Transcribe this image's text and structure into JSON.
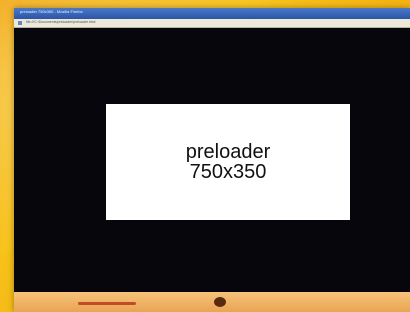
{
  "window": {
    "title": "preloader 750x350 - Mozilla Firefox",
    "url": "file:///C:/Documents/preloader/preloader.html"
  },
  "content": {
    "preloader_line1": "preloader",
    "preloader_line2": "750x350"
  },
  "colors": {
    "desktop_background": "#f7c21a",
    "viewport_background": "#06060c",
    "preloader_box": "#ffffff",
    "footer_strip": "#f2b86a",
    "footer_accent": "#c24a2a"
  },
  "icons": {
    "page_icon": "page-icon",
    "footer_emblem": "emblem-icon"
  }
}
